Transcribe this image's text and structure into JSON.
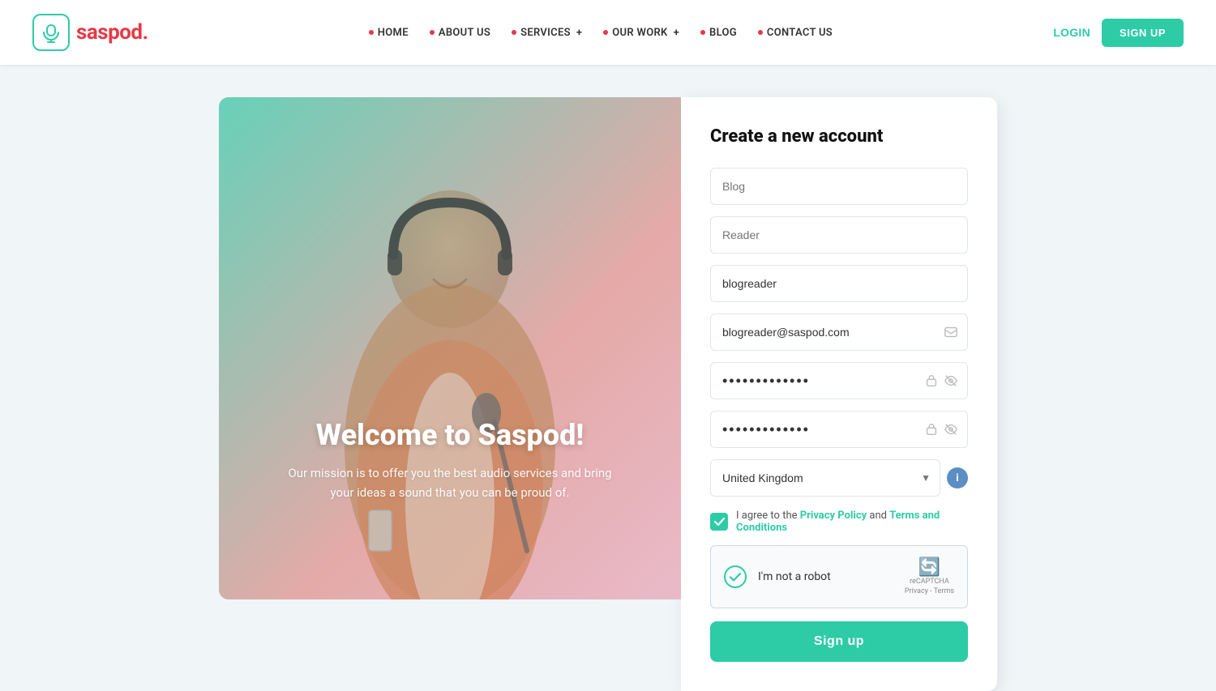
{
  "header": {
    "logo_text": "saspod",
    "logo_dot": ".",
    "nav_items": [
      {
        "label": "HOME",
        "has_dot": true,
        "has_plus": false
      },
      {
        "label": "ABOUT US",
        "has_dot": true,
        "has_plus": false
      },
      {
        "label": "SERVICES",
        "has_dot": true,
        "has_plus": true
      },
      {
        "label": "OUR WORK",
        "has_dot": true,
        "has_plus": true
      },
      {
        "label": "BLOG",
        "has_dot": true,
        "has_plus": false
      },
      {
        "label": "CONTACT US",
        "has_dot": true,
        "has_plus": false
      }
    ],
    "login_label": "LOGIN",
    "signup_label": "SIGN UP"
  },
  "hero": {
    "title": "Welcome to Saspod!",
    "subtitle_line1": "Our mission is to offer you the best audio services and bring",
    "subtitle_line2": "your ideas a sound that you can be proud of."
  },
  "form": {
    "title": "Create a new account",
    "field1_placeholder": "Blog",
    "field1_value": "Blog",
    "field2_placeholder": "Reader",
    "field2_value": "Reader",
    "field3_placeholder": "blogreader",
    "field3_value": "blogreader",
    "field4_placeholder": "blogreader@saspod.com",
    "field4_value": "blogreader@saspod.com",
    "field5_value": "············",
    "field6_value": "············",
    "country_value": "United Kingdom",
    "agree_text_before": "I agree to the ",
    "privacy_policy_label": "Privacy Policy",
    "agree_text_middle": " and ",
    "terms_label": "Terms and Conditions",
    "recaptcha_label": "I'm not a robot",
    "recaptcha_brand": "reCAPTCHA",
    "recaptcha_privacy": "Privacy - Terms",
    "submit_label": "Sign up"
  }
}
